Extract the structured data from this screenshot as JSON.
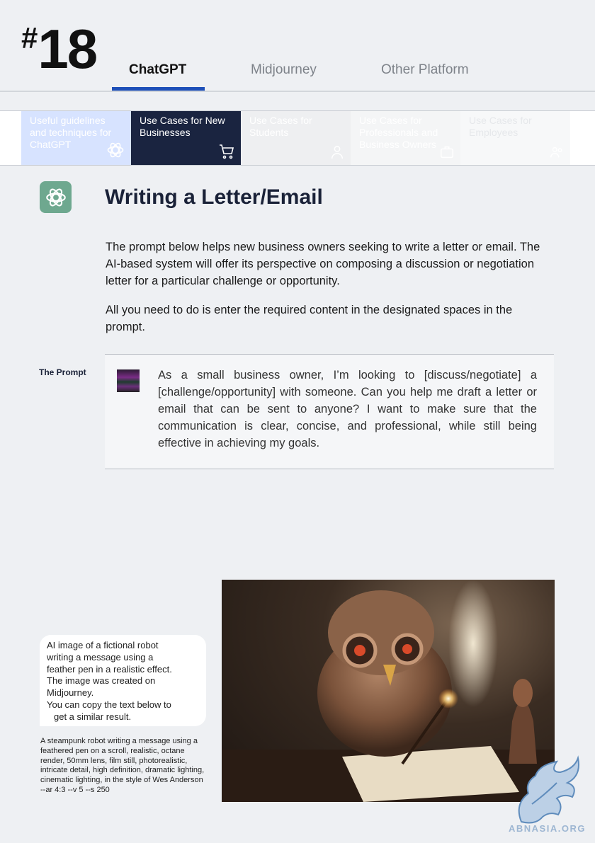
{
  "page_number": {
    "hash": "#",
    "number": "18"
  },
  "tabs": [
    {
      "label": "ChatGPT"
    },
    {
      "label": "Midjourney"
    },
    {
      "label": "Other Platform"
    }
  ],
  "categories": [
    {
      "label": "Useful guidelines and techniques for ChatGPT",
      "icon": "openai-icon",
      "bg": "#d7e3ff",
      "color": "#ffffff"
    },
    {
      "label": "Use Cases for New Businesses",
      "icon": "shopping-cart-icon",
      "bg": "#1a2440",
      "color": "#ffffff"
    },
    {
      "label": "Use Cases for Students",
      "icon": "student-icon",
      "bg": "#eeeff1",
      "color": "#ffffff"
    },
    {
      "label": "Use Cases for Professionals and Business Owners",
      "icon": "briefcase-icon",
      "bg": "#f4f5f6",
      "color": "#ffffff"
    },
    {
      "label": "Use Cases for Employees",
      "icon": "users-icon",
      "bg": "#f7f8f9",
      "color": "#e6e8eb"
    }
  ],
  "section": {
    "icon": "openai-icon",
    "title": "Writing a Letter/Email",
    "paragraph1": "The prompt below helps new business owners seeking to write a letter or email. The AI-based system will offer its perspective on composing a discussion or negotiation letter for a particular challenge or opportunity.",
    "paragraph2": "All you need to do is enter the required content in the designated spaces in the prompt."
  },
  "prompt": {
    "label": "The Prompt",
    "text": "As a small business owner, I’m looking to [discuss/negotiate] a [challenge/opportunity] with someone. Can you help me draft a letter or email that can be sent to anyone? I want to make sure that the communication is clear, concise, and professional, while still being effective in achieving my goals."
  },
  "image_caption": {
    "lines": [
      "AI image of a fictional robot",
      "writing a message using a",
      "feather pen in a realistic effect.",
      "The image was created on",
      "Midjourney.",
      "You can copy the text below to",
      "get a similar result."
    ],
    "midjourney_prompt": "A steampunk robot writing a message using a feathered pen on a scroll, realistic, octane render, 50mm lens, film still, photorealistic, intricate detail, high definition, dramatic lighting, cinematic lighting, in the style of Wes Anderson --ar 4:3 --v 5 --s 250"
  },
  "watermark": {
    "text": "ABNASIA.ORG"
  },
  "colors": {
    "accent": "#1d4fb8",
    "heading": "#1a2238",
    "chip": "#6ea88f"
  }
}
